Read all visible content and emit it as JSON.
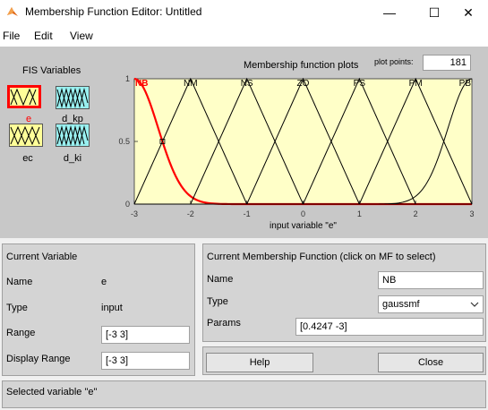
{
  "window": {
    "title": "Membership Function Editor: Untitled",
    "minimize_glyph": "—",
    "maximize_glyph": "☐",
    "close_glyph": "✕",
    "app_icon": "matlab-icon"
  },
  "menu": {
    "file": "File",
    "edit": "Edit",
    "view": "View"
  },
  "fis": {
    "title": "FIS Variables",
    "vars": [
      {
        "name": "e",
        "kind": "input",
        "selected": true,
        "color": "#ffff99"
      },
      {
        "name": "d_kp",
        "kind": "output",
        "selected": false,
        "color": "#99f0f0"
      },
      {
        "name": "ec",
        "kind": "input",
        "selected": false,
        "color": "#ffff99"
      },
      {
        "name": "d_ki",
        "kind": "output",
        "selected": false,
        "color": "#99f0f0"
      }
    ]
  },
  "plot": {
    "title": "Membership function plots",
    "plot_points_label": "plot points:",
    "plot_points": "181",
    "xlabel": "input variable \"e\"",
    "xticks": [
      "-3",
      "-2",
      "-1",
      "0",
      "1",
      "2",
      "3"
    ],
    "yticks": [
      "0",
      "0.5",
      "1"
    ],
    "background": "#ffffc8",
    "selected_color": "#ff0000"
  },
  "chart_data": {
    "type": "line",
    "xlim": [
      -3,
      3
    ],
    "ylim": [
      0,
      1
    ],
    "grid": false,
    "series": [
      {
        "name": "NB",
        "shape": "gaussmf",
        "params": [
          0.4247,
          -3
        ],
        "selected": true
      },
      {
        "name": "NM",
        "shape": "trimf",
        "params": [
          -3,
          -2,
          -1
        ]
      },
      {
        "name": "NS",
        "shape": "trimf",
        "params": [
          -2,
          -1,
          0
        ]
      },
      {
        "name": "ZO",
        "shape": "trimf",
        "params": [
          -1,
          0,
          1
        ]
      },
      {
        "name": "PS",
        "shape": "trimf",
        "params": [
          0,
          1,
          2
        ]
      },
      {
        "name": "PM",
        "shape": "trimf",
        "params": [
          1,
          2,
          3
        ]
      },
      {
        "name": "PB",
        "shape": "gaussmf",
        "params": [
          0.4247,
          3
        ]
      }
    ]
  },
  "current_variable": {
    "title": "Current Variable",
    "name_label": "Name",
    "name_value": "e",
    "type_label": "Type",
    "type_value": "input",
    "range_label": "Range",
    "range_value": "[-3 3]",
    "display_range_label": "Display Range",
    "display_range_value": "[-3 3]"
  },
  "current_mf": {
    "title": "Current Membership Function (click on MF to select)",
    "name_label": "Name",
    "name_value": "NB",
    "type_label": "Type",
    "type_value": "gaussmf",
    "params_label": "Params",
    "params_value": "[0.4247 -3]"
  },
  "buttons": {
    "help": "Help",
    "close": "Close"
  },
  "status": "Selected variable \"e\""
}
